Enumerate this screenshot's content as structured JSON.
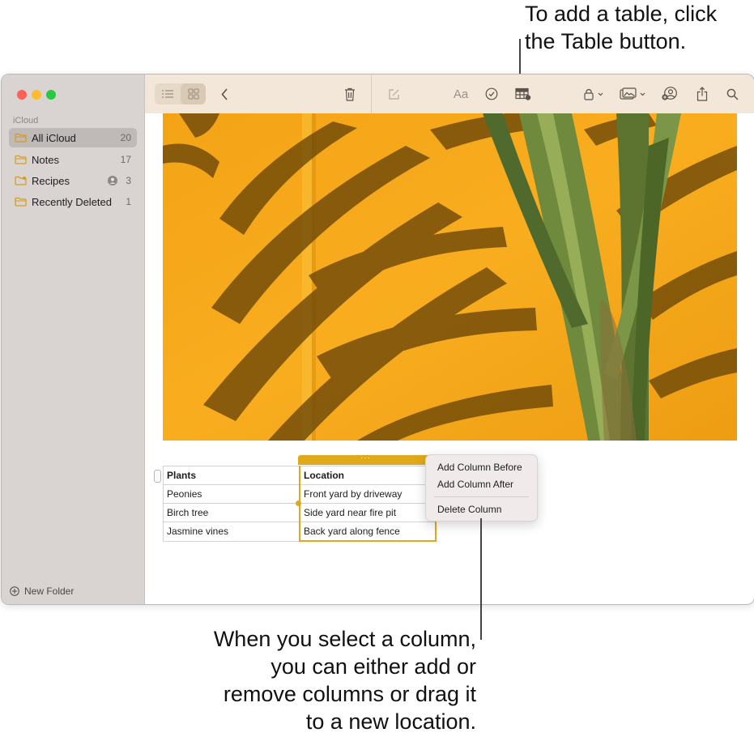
{
  "callouts": {
    "top": "To add a table, click\nthe Table button.",
    "bottom": "When you select a column,\nyou can either add or\nremove columns or drag it\nto a new location."
  },
  "sidebar": {
    "section": "iCloud",
    "folders": [
      {
        "name": "All iCloud",
        "count": "20",
        "selected": true
      },
      {
        "name": "Notes",
        "count": "17"
      },
      {
        "name": "Recipes",
        "count": "3",
        "shared": true
      },
      {
        "name": "Recently Deleted",
        "count": "1"
      }
    ],
    "new_folder": "New Folder"
  },
  "toolbar": {
    "font_button": "Aa",
    "icons": [
      "list-view-icon",
      "gallery-view-icon",
      "back-chevron-icon",
      "trash-icon",
      "compose-icon",
      "format-icon",
      "checklist-icon",
      "table-icon",
      "lock-icon",
      "media-icon",
      "collaborate-icon",
      "share-icon",
      "search-icon"
    ]
  },
  "note": {
    "table": {
      "headers": [
        "Plants",
        "Location"
      ],
      "rows": [
        [
          "Peonies",
          "Front yard by driveway"
        ],
        [
          "Birch tree",
          "Side yard near fire pit"
        ],
        [
          "Jasmine vines",
          "Back yard along fence"
        ]
      ],
      "selected_column": 1
    },
    "column_handle": "···"
  },
  "context_menu": {
    "items": [
      "Add Column Before",
      "Add Column After",
      "Delete Column"
    ]
  },
  "colors": {
    "selection_accent": "#e0a91c",
    "photo_wall": "#f6a81a",
    "sidebar_bg": "#d9d4d2",
    "toolbar_bg": "#f2e7d9"
  }
}
